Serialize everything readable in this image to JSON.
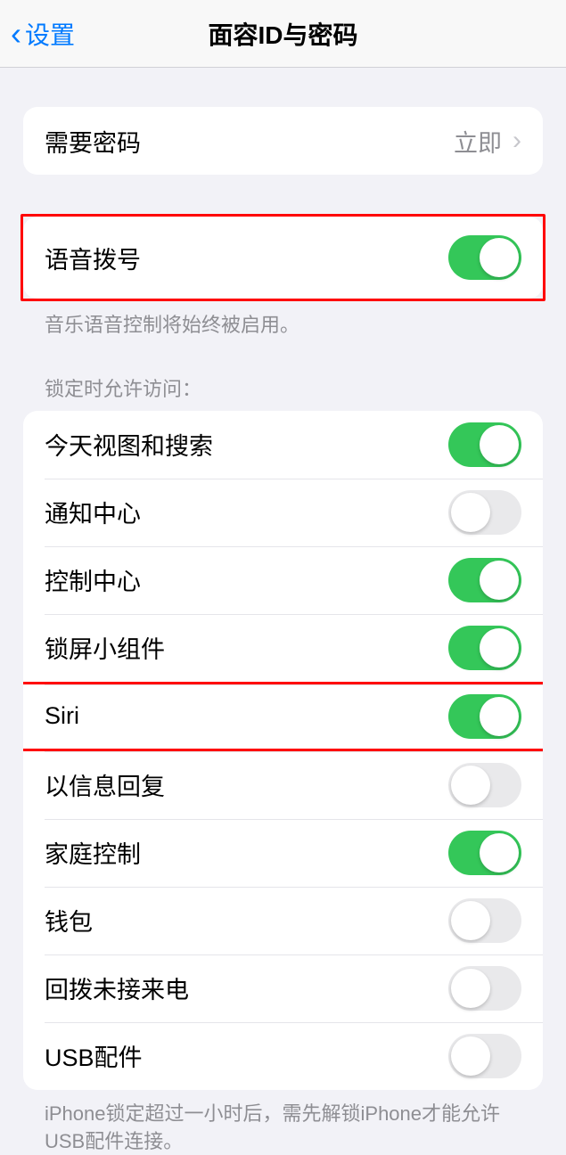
{
  "header": {
    "back_label": "设置",
    "title": "面容ID与密码"
  },
  "require_passcode": {
    "label": "需要密码",
    "value": "立即"
  },
  "voice_dial": {
    "label": "语音拨号",
    "enabled": true,
    "footer": "音乐语音控制将始终被启用。"
  },
  "locked_access": {
    "header": "锁定时允许访问：",
    "items": [
      {
        "label": "今天视图和搜索",
        "enabled": true
      },
      {
        "label": "通知中心",
        "enabled": false
      },
      {
        "label": "控制中心",
        "enabled": true
      },
      {
        "label": "锁屏小组件",
        "enabled": true
      },
      {
        "label": "Siri",
        "enabled": true
      },
      {
        "label": "以信息回复",
        "enabled": false
      },
      {
        "label": "家庭控制",
        "enabled": true
      },
      {
        "label": "钱包",
        "enabled": false
      },
      {
        "label": "回拨未接来电",
        "enabled": false
      },
      {
        "label": "USB配件",
        "enabled": false
      }
    ],
    "footer": "iPhone锁定超过一小时后，需先解锁iPhone才能允许USB配件连接。"
  }
}
